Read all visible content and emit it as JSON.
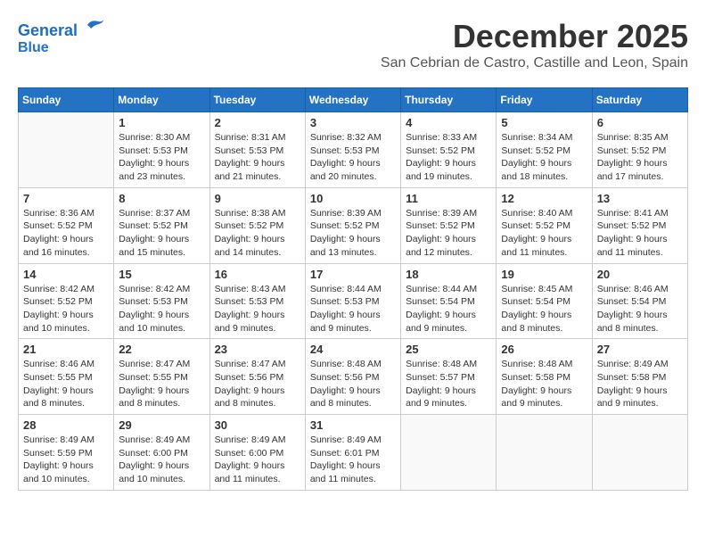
{
  "header": {
    "logo_line1": "General",
    "logo_line2": "Blue",
    "month_title": "December 2025",
    "location": "San Cebrian de Castro, Castille and Leon, Spain"
  },
  "weekdays": [
    "Sunday",
    "Monday",
    "Tuesday",
    "Wednesday",
    "Thursday",
    "Friday",
    "Saturday"
  ],
  "weeks": [
    [
      {
        "day": "",
        "sunrise": "",
        "sunset": "",
        "daylight": ""
      },
      {
        "day": "1",
        "sunrise": "Sunrise: 8:30 AM",
        "sunset": "Sunset: 5:53 PM",
        "daylight": "Daylight: 9 hours and 23 minutes."
      },
      {
        "day": "2",
        "sunrise": "Sunrise: 8:31 AM",
        "sunset": "Sunset: 5:53 PM",
        "daylight": "Daylight: 9 hours and 21 minutes."
      },
      {
        "day": "3",
        "sunrise": "Sunrise: 8:32 AM",
        "sunset": "Sunset: 5:53 PM",
        "daylight": "Daylight: 9 hours and 20 minutes."
      },
      {
        "day": "4",
        "sunrise": "Sunrise: 8:33 AM",
        "sunset": "Sunset: 5:52 PM",
        "daylight": "Daylight: 9 hours and 19 minutes."
      },
      {
        "day": "5",
        "sunrise": "Sunrise: 8:34 AM",
        "sunset": "Sunset: 5:52 PM",
        "daylight": "Daylight: 9 hours and 18 minutes."
      },
      {
        "day": "6",
        "sunrise": "Sunrise: 8:35 AM",
        "sunset": "Sunset: 5:52 PM",
        "daylight": "Daylight: 9 hours and 17 minutes."
      }
    ],
    [
      {
        "day": "7",
        "sunrise": "Sunrise: 8:36 AM",
        "sunset": "Sunset: 5:52 PM",
        "daylight": "Daylight: 9 hours and 16 minutes."
      },
      {
        "day": "8",
        "sunrise": "Sunrise: 8:37 AM",
        "sunset": "Sunset: 5:52 PM",
        "daylight": "Daylight: 9 hours and 15 minutes."
      },
      {
        "day": "9",
        "sunrise": "Sunrise: 8:38 AM",
        "sunset": "Sunset: 5:52 PM",
        "daylight": "Daylight: 9 hours and 14 minutes."
      },
      {
        "day": "10",
        "sunrise": "Sunrise: 8:39 AM",
        "sunset": "Sunset: 5:52 PM",
        "daylight": "Daylight: 9 hours and 13 minutes."
      },
      {
        "day": "11",
        "sunrise": "Sunrise: 8:39 AM",
        "sunset": "Sunset: 5:52 PM",
        "daylight": "Daylight: 9 hours and 12 minutes."
      },
      {
        "day": "12",
        "sunrise": "Sunrise: 8:40 AM",
        "sunset": "Sunset: 5:52 PM",
        "daylight": "Daylight: 9 hours and 11 minutes."
      },
      {
        "day": "13",
        "sunrise": "Sunrise: 8:41 AM",
        "sunset": "Sunset: 5:52 PM",
        "daylight": "Daylight: 9 hours and 11 minutes."
      }
    ],
    [
      {
        "day": "14",
        "sunrise": "Sunrise: 8:42 AM",
        "sunset": "Sunset: 5:52 PM",
        "daylight": "Daylight: 9 hours and 10 minutes."
      },
      {
        "day": "15",
        "sunrise": "Sunrise: 8:42 AM",
        "sunset": "Sunset: 5:53 PM",
        "daylight": "Daylight: 9 hours and 10 minutes."
      },
      {
        "day": "16",
        "sunrise": "Sunrise: 8:43 AM",
        "sunset": "Sunset: 5:53 PM",
        "daylight": "Daylight: 9 hours and 9 minutes."
      },
      {
        "day": "17",
        "sunrise": "Sunrise: 8:44 AM",
        "sunset": "Sunset: 5:53 PM",
        "daylight": "Daylight: 9 hours and 9 minutes."
      },
      {
        "day": "18",
        "sunrise": "Sunrise: 8:44 AM",
        "sunset": "Sunset: 5:54 PM",
        "daylight": "Daylight: 9 hours and 9 minutes."
      },
      {
        "day": "19",
        "sunrise": "Sunrise: 8:45 AM",
        "sunset": "Sunset: 5:54 PM",
        "daylight": "Daylight: 9 hours and 8 minutes."
      },
      {
        "day": "20",
        "sunrise": "Sunrise: 8:46 AM",
        "sunset": "Sunset: 5:54 PM",
        "daylight": "Daylight: 9 hours and 8 minutes."
      }
    ],
    [
      {
        "day": "21",
        "sunrise": "Sunrise: 8:46 AM",
        "sunset": "Sunset: 5:55 PM",
        "daylight": "Daylight: 9 hours and 8 minutes."
      },
      {
        "day": "22",
        "sunrise": "Sunrise: 8:47 AM",
        "sunset": "Sunset: 5:55 PM",
        "daylight": "Daylight: 9 hours and 8 minutes."
      },
      {
        "day": "23",
        "sunrise": "Sunrise: 8:47 AM",
        "sunset": "Sunset: 5:56 PM",
        "daylight": "Daylight: 9 hours and 8 minutes."
      },
      {
        "day": "24",
        "sunrise": "Sunrise: 8:48 AM",
        "sunset": "Sunset: 5:56 PM",
        "daylight": "Daylight: 9 hours and 8 minutes."
      },
      {
        "day": "25",
        "sunrise": "Sunrise: 8:48 AM",
        "sunset": "Sunset: 5:57 PM",
        "daylight": "Daylight: 9 hours and 9 minutes."
      },
      {
        "day": "26",
        "sunrise": "Sunrise: 8:48 AM",
        "sunset": "Sunset: 5:58 PM",
        "daylight": "Daylight: 9 hours and 9 minutes."
      },
      {
        "day": "27",
        "sunrise": "Sunrise: 8:49 AM",
        "sunset": "Sunset: 5:58 PM",
        "daylight": "Daylight: 9 hours and 9 minutes."
      }
    ],
    [
      {
        "day": "28",
        "sunrise": "Sunrise: 8:49 AM",
        "sunset": "Sunset: 5:59 PM",
        "daylight": "Daylight: 9 hours and 10 minutes."
      },
      {
        "day": "29",
        "sunrise": "Sunrise: 8:49 AM",
        "sunset": "Sunset: 6:00 PM",
        "daylight": "Daylight: 9 hours and 10 minutes."
      },
      {
        "day": "30",
        "sunrise": "Sunrise: 8:49 AM",
        "sunset": "Sunset: 6:00 PM",
        "daylight": "Daylight: 9 hours and 11 minutes."
      },
      {
        "day": "31",
        "sunrise": "Sunrise: 8:49 AM",
        "sunset": "Sunset: 6:01 PM",
        "daylight": "Daylight: 9 hours and 11 minutes."
      },
      {
        "day": "",
        "sunrise": "",
        "sunset": "",
        "daylight": ""
      },
      {
        "day": "",
        "sunrise": "",
        "sunset": "",
        "daylight": ""
      },
      {
        "day": "",
        "sunrise": "",
        "sunset": "",
        "daylight": ""
      }
    ]
  ]
}
